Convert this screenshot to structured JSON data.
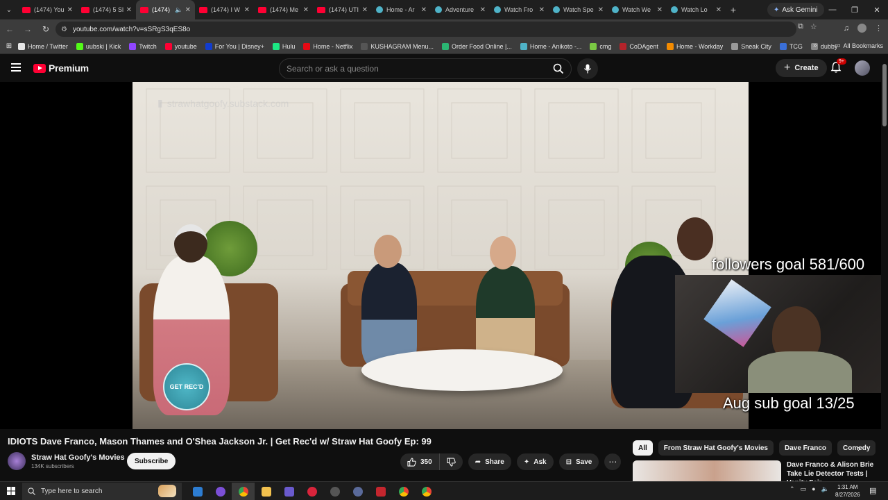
{
  "browser": {
    "tabs": [
      {
        "title": "(1474) You",
        "type": "yt"
      },
      {
        "title": "(1474) 5 Sl",
        "type": "yt"
      },
      {
        "title": "(1474)",
        "type": "yt",
        "active": true
      },
      {
        "title": "(1474) I W",
        "type": "yt"
      },
      {
        "title": "(1474) Me",
        "type": "yt"
      },
      {
        "title": "(1474) UTI",
        "type": "yt"
      },
      {
        "title": "Home - Ar",
        "type": "globe"
      },
      {
        "title": "Adventure",
        "type": "globe"
      },
      {
        "title": "Watch Fro",
        "type": "globe"
      },
      {
        "title": "Watch Spe",
        "type": "globe"
      },
      {
        "title": "Watch We",
        "type": "globe"
      },
      {
        "title": "Watch Lo",
        "type": "globe"
      }
    ],
    "ask_gemini": "Ask Gemini",
    "url": "youtube.com/watch?v=sSRgS3qES8o",
    "bookmarks": [
      {
        "label": "Home / Twitter",
        "color": "#e7e7e7",
        "glyph": "X"
      },
      {
        "label": "uubski | Kick",
        "color": "#53fc18",
        "glyph": "K"
      },
      {
        "label": "Twitch",
        "color": "#9146ff",
        "glyph": ""
      },
      {
        "label": "youtube",
        "color": "#ff0033",
        "glyph": ""
      },
      {
        "label": "For You | Disney+",
        "color": "#113ccf",
        "glyph": ""
      },
      {
        "label": "Hulu",
        "color": "#1ce783",
        "glyph": "h"
      },
      {
        "label": "Home - Netflix",
        "color": "#e50914",
        "glyph": ""
      },
      {
        "label": "KUSHAGRAM Menu...",
        "color": "#555555",
        "glyph": ""
      },
      {
        "label": "Order Food Online |...",
        "color": "#2bb673",
        "glyph": ""
      },
      {
        "label": "Home - Anikoto -...",
        "color": "#4fb3c8",
        "glyph": ""
      },
      {
        "label": "cmg",
        "color": "#7ac943",
        "glyph": ""
      },
      {
        "label": "CoDAgent",
        "color": "#b4232a",
        "glyph": ""
      },
      {
        "label": "Home - Workday",
        "color": "#f38b00",
        "glyph": ""
      },
      {
        "label": "Sneak City",
        "color": "#999999",
        "glyph": ""
      },
      {
        "label": "TCG",
        "color": "#3a6fd8",
        "glyph": ""
      },
      {
        "label": "dubby",
        "color": "#888888",
        "glyph": ""
      }
    ],
    "all_bookmarks": "All Bookmarks"
  },
  "youtube": {
    "logo_text": "Premium",
    "search_placeholder": "Search or ask a question",
    "create_label": "Create",
    "notification_badge": "9+",
    "video": {
      "watermark": "strawhatgoofy.substack.com",
      "badge_text": "GET REC'D",
      "overlay_followers": "followers goal 581/600",
      "overlay_sub": "Aug sub goal 13/25"
    },
    "title": "IDIOTS Dave Franco, Mason Thames and O'Shea Jackson Jr. | Get Rec'd w/ Straw Hat Goofy Ep: 99",
    "channel": {
      "name": "Straw Hat Goofy's Movies",
      "subs": "134K subscribers",
      "subscribe": "Subscribe"
    },
    "actions": {
      "likes": "350",
      "share": "Share",
      "ask": "Ask",
      "save": "Save"
    },
    "chips": [
      "All",
      "From Straw Hat Goofy's Movies",
      "Dave Franco",
      "Comedy"
    ],
    "recommended": {
      "title": "Dave Franco & Alison Brie Take Lie Detector Tests | Vanity Fair"
    }
  },
  "taskbar": {
    "search_placeholder": "Type here to search",
    "time": "1:31 AM",
    "date": "8/27/2026"
  }
}
